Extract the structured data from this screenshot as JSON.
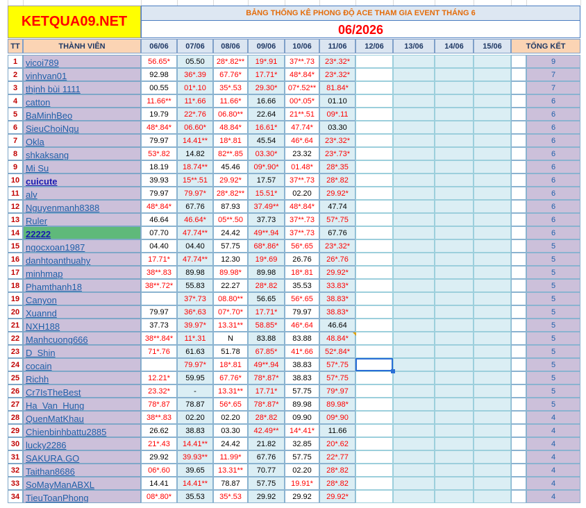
{
  "banner": {
    "logo": "KETQUA09.NET",
    "title": "BẢNG THỐNG KÊ PHONG ĐỘ ACE THAM GIA EVENT THÁNG 6",
    "month": "06/2026"
  },
  "headers": {
    "tt": "TT",
    "member": "THÀNH VIÊN",
    "dates": [
      "06/06",
      "07/06",
      "08/06",
      "09/06",
      "10/06",
      "11/06",
      "12/06",
      "13/06",
      "14/06",
      "15/06"
    ],
    "total": "TỔNG KẾT"
  },
  "colors": {
    "red_value": "#ff0000",
    "name_link": "#1f5fa8",
    "logo_bg": "#ffff00",
    "title_orange": "#e46c0a"
  },
  "rows": [
    {
      "tt": "1",
      "name": "vicoi789",
      "v": [
        "56.65*",
        "05.50",
        "28*.82**",
        "19*.91",
        "37**.73",
        "23*.32*"
      ],
      "total": "9"
    },
    {
      "tt": "2",
      "name": "vinhvan01",
      "v": [
        "92.98",
        "36*.39",
        "67.76*",
        "17.71*",
        "48*.84*",
        "23*.32*"
      ],
      "total": "7"
    },
    {
      "tt": "3",
      "name": "thịnh bùi 1111",
      "v": [
        "00.55",
        "01*.10",
        "35*.53",
        "29.30*",
        "07*.52**",
        "81.84*"
      ],
      "total": "7"
    },
    {
      "tt": "4",
      "name": "catton",
      "v": [
        "11.66**",
        "11*.66",
        "11.66*",
        "16.66",
        "00*.05*",
        "01.10"
      ],
      "total": "6"
    },
    {
      "tt": "5",
      "name": "BaMinhBeo",
      "v": [
        "19.79",
        "22*.76",
        "06.80**",
        "22.64",
        "21**.51",
        "09*.11"
      ],
      "total": "6"
    },
    {
      "tt": "6",
      "name": "SieuChoiNgu",
      "v": [
        "48*.84*",
        "06.60*",
        "48.84*",
        "16.61*",
        "47.74*",
        "03.30"
      ],
      "total": "6"
    },
    {
      "tt": "7",
      "name": "Okla",
      "v": [
        "79.97",
        "14.41**",
        "18*.81",
        "45.54",
        "46*.64",
        "23*.32*"
      ],
      "total": "6"
    },
    {
      "tt": "8",
      "name": "shkaksang",
      "v": [
        "53*.82",
        "14.82",
        "82**.85",
        "03.30*",
        "23.32",
        "23*.73*"
      ],
      "total": "6"
    },
    {
      "tt": "9",
      "name": "Mi Su",
      "v": [
        "18.19",
        "18.74**",
        "45.46",
        "09*.90*",
        "01.48*",
        "28*.35"
      ],
      "total": "6"
    },
    {
      "tt": "10",
      "name": "cuicute",
      "v": [
        "39.93",
        "15**.51",
        "29.92*",
        "17.57",
        "37**.73",
        "28*.82"
      ],
      "total": "6"
    },
    {
      "tt": "11",
      "name": "alv",
      "v": [
        "79.97",
        "79.97*",
        "28*.82**",
        "15.51*",
        "02.20",
        "29.92*"
      ],
      "total": "6"
    },
    {
      "tt": "12",
      "name": "Nguyenmanh8388",
      "v": [
        "48*.84*",
        "67.76",
        "87.93",
        "37.49**",
        "48*.84*",
        "47.74"
      ],
      "total": "6"
    },
    {
      "tt": "13",
      "name": "Ruler",
      "v": [
        "46.64",
        "46.64*",
        "05**.50",
        "37.73",
        "37**.73",
        "57*.75"
      ],
      "total": "6"
    },
    {
      "tt": "14",
      "name": "22222",
      "v": [
        "07.70",
        "47.74**",
        "24.42",
        "49**.94",
        "37**.73",
        "67.76"
      ],
      "total": "6"
    },
    {
      "tt": "15",
      "name": "ngocxoan1987",
      "v": [
        "04.40",
        "04.40",
        "57.75",
        "68*.86*",
        "56*.65",
        "23*.32*"
      ],
      "total": "5"
    },
    {
      "tt": "16",
      "name": "danhtoanthuahy",
      "v": [
        "17.71*",
        "47.74**",
        "12.30",
        "19*.69",
        "26.76",
        "26*.76"
      ],
      "total": "5"
    },
    {
      "tt": "17",
      "name": "minhmap",
      "v": [
        "38**.83",
        "89.98",
        "89.98*",
        "89.98",
        "18*.81",
        "29.92*"
      ],
      "total": "5"
    },
    {
      "tt": "18",
      "name": "Phamthanh18",
      "v": [
        "38**.72*",
        "55.83",
        "22.27",
        "28*.82",
        "35.53",
        "33.83*"
      ],
      "total": "5"
    },
    {
      "tt": "19",
      "name": "Canyon",
      "v": [
        "",
        "37*.73",
        "08.80**",
        "56.65",
        "56*.65",
        "38.83*"
      ],
      "total": "5"
    },
    {
      "tt": "20",
      "name": "Xuannd",
      "v": [
        "79.97",
        "36*.63",
        "07*.70*",
        "17.71*",
        "79.97",
        "38.83*"
      ],
      "total": "5"
    },
    {
      "tt": "21",
      "name": "NXH188",
      "v": [
        "37.73",
        "39.97*",
        "13.31**",
        "58.85*",
        "46*.64",
        "46.64"
      ],
      "total": "5"
    },
    {
      "tt": "22",
      "name": "Manhcuong666",
      "v": [
        "38**.84*",
        "11*.31",
        "N",
        "83.88",
        "83.88",
        "48.84*"
      ],
      "total": "5"
    },
    {
      "tt": "23",
      "name": "D_Shin",
      "v": [
        "71*.76",
        "61.63",
        "51.78",
        "67.85*",
        "41*.66",
        "52*.84*"
      ],
      "total": "5"
    },
    {
      "tt": "24",
      "name": "cocain",
      "v": [
        "",
        "79.97*",
        "18*.81",
        "49**.94",
        "38.83",
        "57*.75"
      ],
      "total": "5"
    },
    {
      "tt": "25",
      "name": "Richh",
      "v": [
        "12.21*",
        "59.95",
        "67.76*",
        "78*.87*",
        "38.83",
        "57*.75"
      ],
      "total": "5"
    },
    {
      "tt": "26",
      "name": "Cr7IsTheBest",
      "v": [
        "23.32*",
        "-",
        "13.31**",
        "17.71*",
        "57.75",
        "79*.97"
      ],
      "total": "5"
    },
    {
      "tt": "27",
      "name": "Ha_Van_Hung",
      "v": [
        "78*.87",
        "78.87",
        "56*.65",
        "78*.87*",
        "89.98",
        "89.98*"
      ],
      "total": "5"
    },
    {
      "tt": "28",
      "name": "QuenMatKhau",
      "v": [
        "38**.83",
        "02.20",
        "02.20",
        "28*.82",
        "09.90",
        "09*.90"
      ],
      "total": "4"
    },
    {
      "tt": "29",
      "name": "Chienbinhbattu2885",
      "v": [
        "26.62",
        "38.83",
        "03.30",
        "42.49**",
        "14*.41*",
        "11.66"
      ],
      "total": "4"
    },
    {
      "tt": "30",
      "name": "lucky2286",
      "v": [
        "21*.43",
        "14.41**",
        "24.42",
        "21.82",
        "32.85",
        "20*.62"
      ],
      "total": "4"
    },
    {
      "tt": "31",
      "name": "SAKURA.GO",
      "v": [
        "29.92",
        "39.93**",
        "11.99*",
        "67.76",
        "57.75",
        "22*.77"
      ],
      "total": "4"
    },
    {
      "tt": "32",
      "name": "Taithan8686",
      "v": [
        "06*.60",
        "39.65",
        "13.31**",
        "70.77",
        "02.20",
        "28*.82"
      ],
      "total": "4"
    },
    {
      "tt": "33",
      "name": "SoMayManABXL",
      "v": [
        "14.41",
        "14.41**",
        "78.87",
        "57.75",
        "19.91*",
        "28*.82"
      ],
      "total": "4"
    },
    {
      "tt": "34",
      "name": "TieuToanPhong",
      "v": [
        "08*.80*",
        "35.53",
        "35*.53",
        "29.92",
        "29.92",
        "29.92*"
      ],
      "total": "4"
    }
  ]
}
